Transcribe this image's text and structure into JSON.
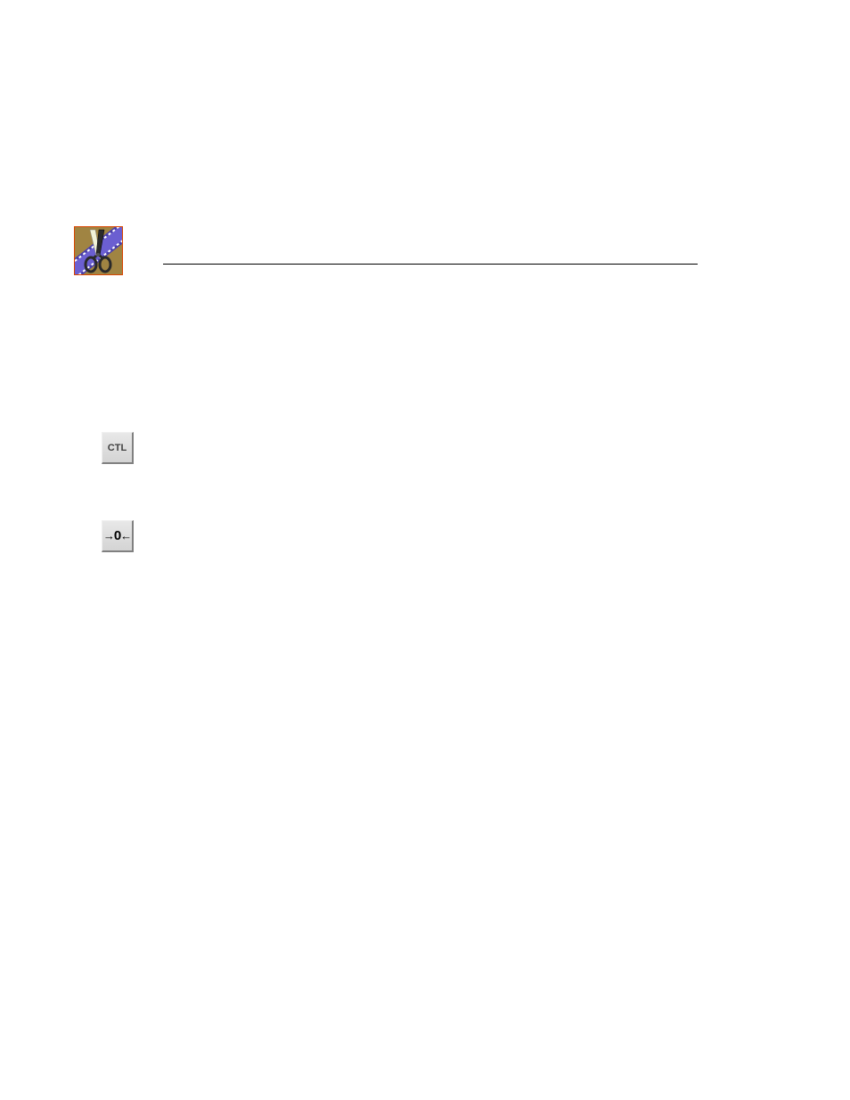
{
  "header": {
    "app_icon_alt": "Movie editor application icon with scissors cutting film strip"
  },
  "toolbar": {
    "ctl_button_label": "CTL",
    "zero_button_label": "→0←"
  }
}
